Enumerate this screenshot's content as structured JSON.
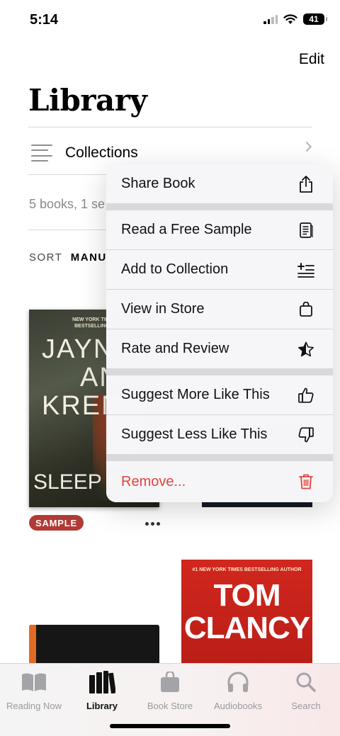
{
  "status_bar": {
    "time": "5:14",
    "battery": "41"
  },
  "header": {
    "edit_label": "Edit",
    "title": "Library"
  },
  "collections": {
    "label": "Collections"
  },
  "library": {
    "count_text": "5 books, 1 se",
    "sort_prefix": "SORT",
    "sort_value": "MANU"
  },
  "books": {
    "jayne": {
      "top_text": "NEW YORK TIMES\nBESTSELLING A",
      "name_lines": [
        "JAYN",
        "AN",
        "KREN"
      ],
      "title": "SLEEP NO"
    },
    "clancy": {
      "top_text": "#1 NEW YORK TIMES BESTSELLING AUTHOR",
      "name_lines": [
        "TOM",
        "CLANCY"
      ]
    },
    "sample_badge": "SAMPLE"
  },
  "context_menu": {
    "items": [
      {
        "label": "Share Book",
        "icon": "share-icon"
      },
      {
        "label": "Read a Free Sample",
        "icon": "sample-page-icon"
      },
      {
        "label": "Add to Collection",
        "icon": "add-to-list-icon"
      },
      {
        "label": "View in Store",
        "icon": "store-bag-icon"
      },
      {
        "label": "Rate and Review",
        "icon": "star-icon"
      },
      {
        "label": "Suggest More Like This",
        "icon": "thumbs-up-icon"
      },
      {
        "label": "Suggest Less Like This",
        "icon": "thumbs-down-icon"
      },
      {
        "label": "Remove...",
        "icon": "trash-icon"
      }
    ],
    "destructive_color": "#e5433a"
  },
  "tab_bar": {
    "tabs": [
      {
        "label": "Reading Now",
        "icon": "book-open-icon",
        "active": false
      },
      {
        "label": "Library",
        "icon": "books-stack-icon",
        "active": true
      },
      {
        "label": "Book Store",
        "icon": "shopping-bag-icon",
        "active": false
      },
      {
        "label": "Audiobooks",
        "icon": "headphones-icon",
        "active": false
      },
      {
        "label": "Search",
        "icon": "search-icon",
        "active": false
      }
    ]
  }
}
